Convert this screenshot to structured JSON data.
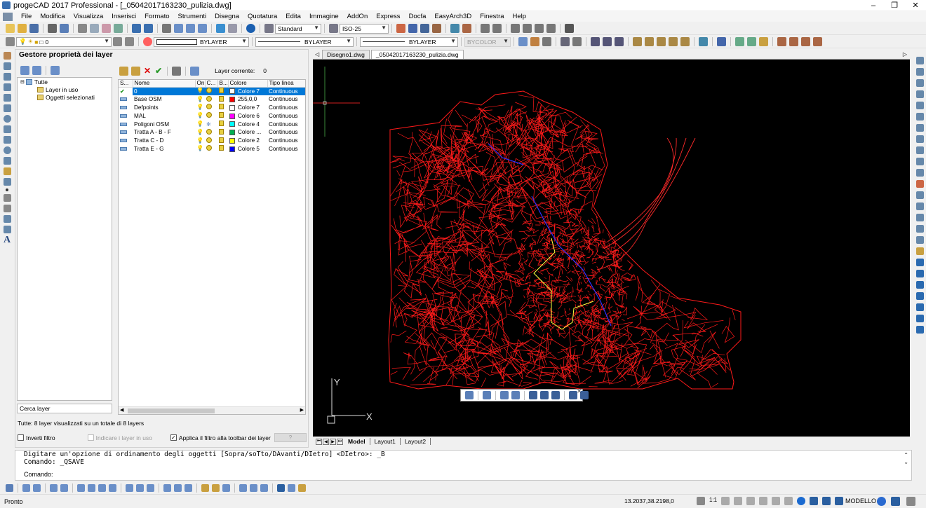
{
  "window": {
    "title": "progeCAD 2017 Professional - [_05042017163230_pulizia.dwg]",
    "controls": [
      "–",
      "❐",
      "✕"
    ]
  },
  "menu": [
    "File",
    "Modifica",
    "Visualizza",
    "Inserisci",
    "Formato",
    "Strumenti",
    "Disegna",
    "Quotatura",
    "Edita",
    "Immagine",
    "AddOn",
    "Express",
    "Docfa",
    "EasyArch3D",
    "Finestra",
    "Help"
  ],
  "toolbar1": {
    "text_style": "Standard",
    "dim_style": "ISO-25"
  },
  "toolbar2": {
    "layer": "0",
    "color": "BYLAYER",
    "linetype": "BYLAYER",
    "lineweight": "BYLAYER",
    "plotstyle": "BYCOLOR"
  },
  "layer_panel": {
    "title": "Gestore proprietà dei layer",
    "current_layer_label": "Layer corrente:",
    "current_layer_value": "0",
    "tree": [
      "Tutte",
      "Layer in uso",
      "Oggetti selezionati"
    ],
    "search_placeholder": "Cerca layer",
    "columns": [
      "S...",
      "Nome",
      "On",
      "C...",
      "B...",
      "Colore",
      "Tipo linea"
    ],
    "layers": [
      {
        "name": "0",
        "color_name": "Colore 7",
        "color_hex": "#ffffff",
        "linetype": "Continuous",
        "current": true
      },
      {
        "name": "Base OSM",
        "color_name": "255,0,0",
        "color_hex": "#ff0000",
        "linetype": "Continuous",
        "current": false
      },
      {
        "name": "Defpoints",
        "color_name": "Colore 7",
        "color_hex": "#ffffff",
        "linetype": "Continuous",
        "current": false
      },
      {
        "name": "MAL",
        "color_name": "Colore 6",
        "color_hex": "#ff00ff",
        "linetype": "Continuous",
        "current": false
      },
      {
        "name": "Poligoni OSM",
        "color_name": "Colore 4",
        "color_hex": "#00ffff",
        "linetype": "Continuous",
        "current": false
      },
      {
        "name": "Tratta A - B - F",
        "color_name": "Colore ...",
        "color_hex": "#00b050",
        "linetype": "Continuous",
        "current": false
      },
      {
        "name": "Tratta C - D",
        "color_name": "Colore 2",
        "color_hex": "#ffff00",
        "linetype": "Continuous",
        "current": false
      },
      {
        "name": "Tratta E - G",
        "color_name": "Colore 5",
        "color_hex": "#0000ff",
        "linetype": "Continuous",
        "current": false
      }
    ],
    "status": "Tutte: 8 layer visualizzati su un totale di 8 layers",
    "invert_filter": "Inverti filtro",
    "show_used": "Indicare i layer in uso",
    "apply_filter": "Applica il filtro alla toolbar dei layer",
    "help_btn": "?"
  },
  "doc_tabs": [
    "Disegno1.dwg",
    "_05042017163230_pulizia.dwg"
  ],
  "layout_tabs": [
    "Model",
    "Layout1",
    "Layout2"
  ],
  "ucs": {
    "x": "X",
    "y": "Y"
  },
  "command": {
    "history1": "Digitare un'opzione di ordinamento degli oggetti [Sopra/soTto/DAvanti/DIetro] <DIetro>: _B",
    "history2": "Comando: _QSAVE",
    "prompt": "Comando:"
  },
  "status_bar": {
    "left": "Pronto",
    "coords": "13.2037,38.2198,0",
    "scale": "1:1",
    "mode": "MODELLO"
  }
}
